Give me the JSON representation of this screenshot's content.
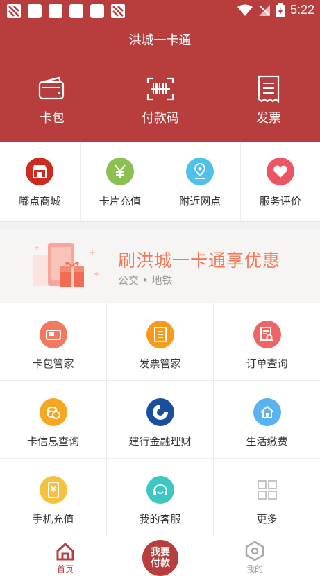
{
  "status_bar": {
    "time": "5:22"
  },
  "app_title": "洪城一卡通",
  "top_actions": [
    {
      "label": "卡包",
      "icon": "wallet-icon"
    },
    {
      "label": "付款码",
      "icon": "barcode-scan-icon"
    },
    {
      "label": "发票",
      "icon": "receipt-icon"
    }
  ],
  "quick_menu": [
    {
      "label": "嘟点商城",
      "icon": "store-icon",
      "color": "#cc2b1d"
    },
    {
      "label": "卡片充值",
      "icon": "yen-icon",
      "color": "#8cc152"
    },
    {
      "label": "附近网点",
      "icon": "location-pin-icon",
      "color": "#4fc1e9"
    },
    {
      "label": "服务评价",
      "icon": "heart-icon",
      "color": "#ed5565"
    }
  ],
  "banner": {
    "title": "刷洪城一卡通享优惠",
    "subtitle": "公交 • 地铁",
    "accent": "#f07a5a"
  },
  "services": [
    {
      "label": "卡包管家",
      "icon": "card-wallet-icon",
      "color": "#f27860"
    },
    {
      "label": "发票管家",
      "icon": "invoice-icon",
      "color": "#f99a1c"
    },
    {
      "label": "订单查询",
      "icon": "order-search-icon",
      "color": "#f06464"
    },
    {
      "label": "卡信息查询",
      "icon": "coins-icon",
      "color": "#f6a623"
    },
    {
      "label": "建行金融理财",
      "icon": "ccb-logo-icon",
      "color": "#1a4fa0"
    },
    {
      "label": "生活缴费",
      "icon": "home-bill-icon",
      "color": "#5ab3f0"
    },
    {
      "label": "手机充值",
      "icon": "phone-recharge-icon",
      "color": "#f6c23e"
    },
    {
      "label": "我的客服",
      "icon": "headset-icon",
      "color": "#3cc8c0"
    },
    {
      "label": "更多",
      "icon": "grid-more-icon",
      "color": "#c8c8c8"
    }
  ],
  "tabbar": {
    "home_label": "首页",
    "center_line1": "我要",
    "center_line2": "付款",
    "mine_label": "我的",
    "active_color": "#b83d3d",
    "inactive_color": "#999999"
  }
}
